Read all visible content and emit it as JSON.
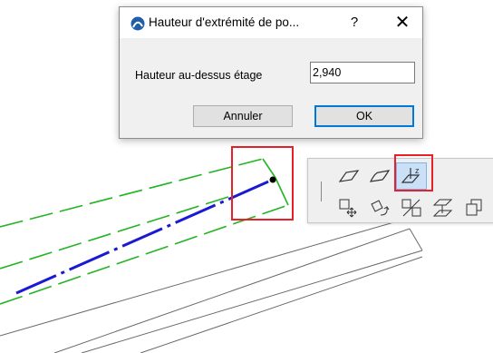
{
  "dialog": {
    "title": "Hauteur d'extrémité de po...",
    "help_label": "?",
    "close_label": "✕",
    "field_label": "Hauteur au-dessus étage",
    "field_value": "2,940",
    "cancel_label": "Annuler",
    "ok_label": "OK"
  },
  "palette": {
    "tools": [
      {
        "icon": "slope-plane-icon"
      },
      {
        "icon": "curved-plane-icon"
      },
      {
        "icon": "elevation-z-icon",
        "selected": true
      },
      {
        "icon": "move-node-icon"
      },
      {
        "icon": "rotate-icon"
      },
      {
        "icon": "offset-edges-icon"
      },
      {
        "icon": "elevate-icon"
      },
      {
        "icon": "copy-icon"
      }
    ]
  },
  "colors": {
    "highlight_red": "#e8202a",
    "reference_line_green": "#22b422",
    "axis_line_blue": "#1a1ad4",
    "selection_blue": "#c9e0f7"
  }
}
